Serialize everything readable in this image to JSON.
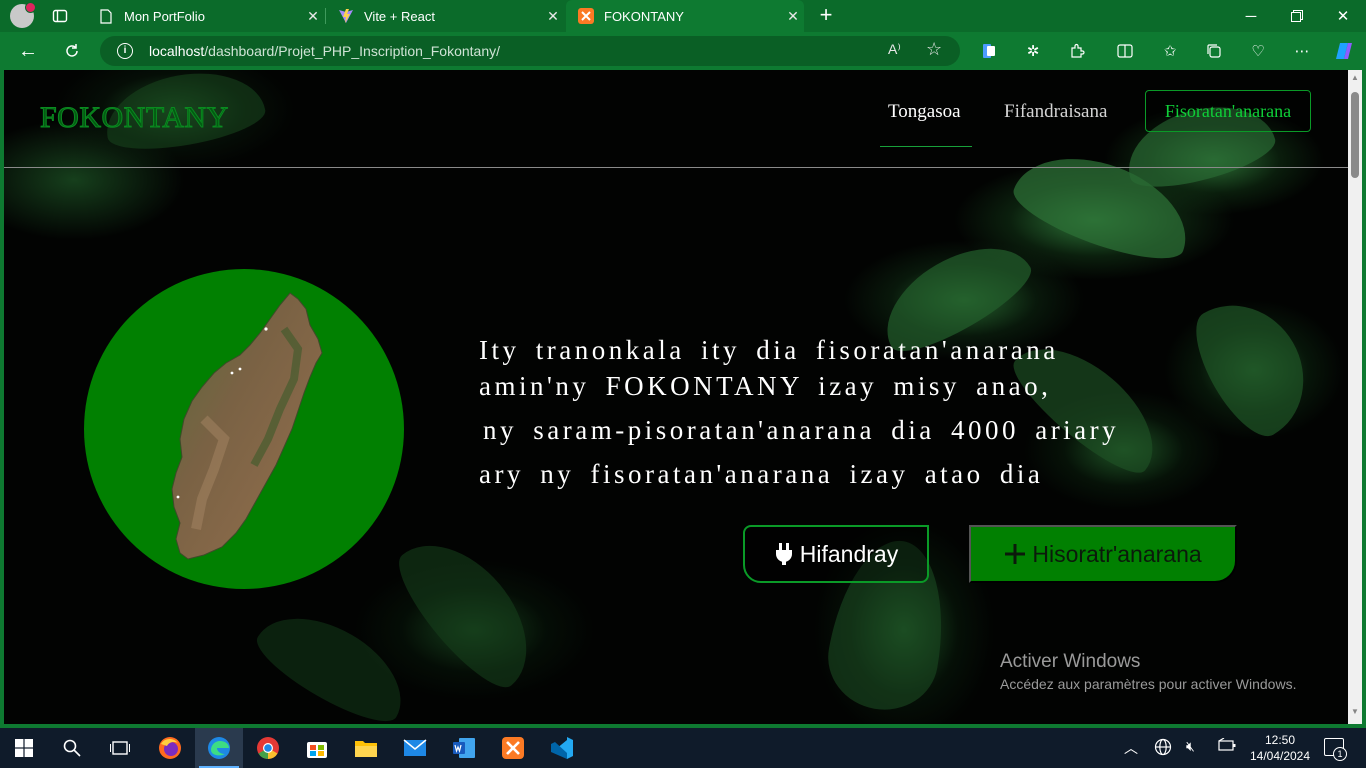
{
  "browser": {
    "tabs": [
      {
        "title": "Mon PortFolio",
        "icon": "page-icon",
        "active": false
      },
      {
        "title": "Vite + React",
        "icon": "vite-icon",
        "active": false
      },
      {
        "title": "FOKONTANY",
        "icon": "xampp-icon",
        "active": true
      }
    ],
    "address": {
      "host": "localhost",
      "path": "/dashboard/Projet_PHP_Inscription_Fokontany/"
    },
    "read_aloud_label": "A⁾"
  },
  "site": {
    "logo": "FOKONTANY",
    "nav": {
      "home": "Tongasoa",
      "login": "Fifandraisana",
      "register": "Fisoratan'anarana"
    },
    "hero": {
      "line1": "Ity tranonkala ity dia fisoratan'anarana",
      "line2": "amin'ny FOKONTANY izay misy anao,",
      "line3": "ny saram-pisoratan'anarana dia 4000 ariary",
      "line4": "ary ny fisoratan'anarana izay atao dia"
    },
    "buttons": {
      "connect": "Hifandray",
      "register": "Hisoratr'anarana"
    },
    "colors": {
      "brand_green": "#018001",
      "accent_green": "#0a9a27"
    }
  },
  "watermark": {
    "title": "Activer Windows",
    "subtitle": "Accédez aux paramètres pour activer Windows."
  },
  "taskbar": {
    "time": "12:50",
    "date": "14/04/2024",
    "notification_count": "1",
    "apps": [
      "windows-start-icon",
      "search-icon",
      "task-view-icon",
      "firefox-icon",
      "edge-icon",
      "chrome-icon",
      "store-icon",
      "file-explorer-icon",
      "mail-icon",
      "word-icon",
      "xampp-icon",
      "vscode-icon"
    ]
  }
}
